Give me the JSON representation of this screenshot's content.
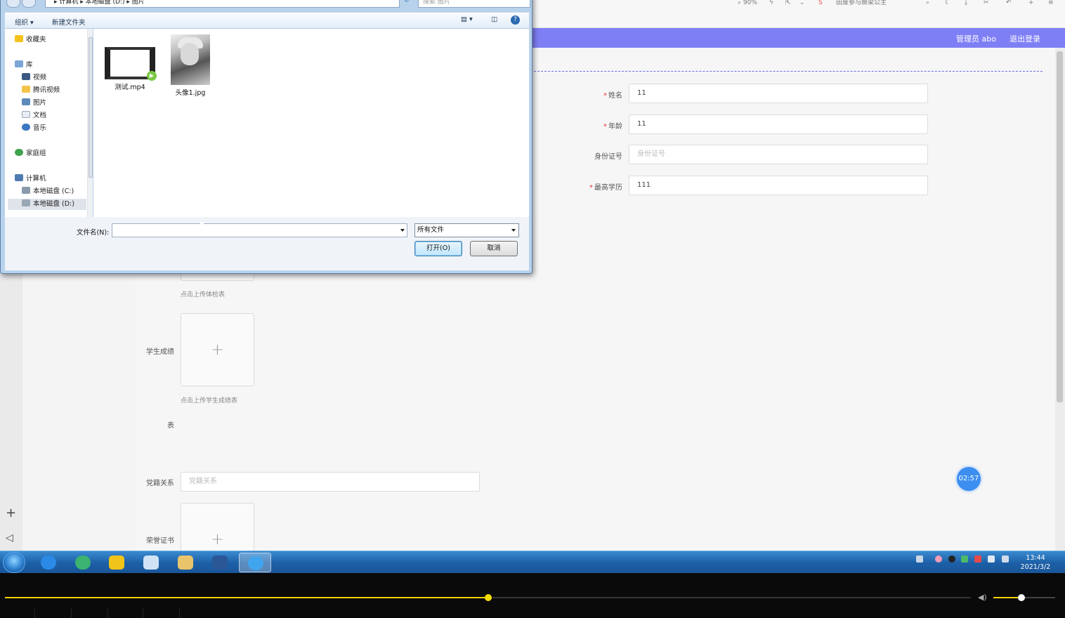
{
  "browser": {
    "zoom": "90%",
    "hot_search": "田度参与撕梁公主"
  },
  "app_header": {
    "admin_label": "管理员 abo",
    "logout_label": "退出登录"
  },
  "form": {
    "name": {
      "label": "姓名",
      "value": "11"
    },
    "age": {
      "label": "年龄",
      "value": "11"
    },
    "id_card": {
      "label": "身份证号",
      "placeholder": "身份证号"
    },
    "education": {
      "label": "最高学历",
      "value": "111"
    },
    "medical_hint": "点击上传体检表",
    "grades_label": "学生成绩",
    "grades_hint": "点击上传学生成绩表",
    "stray_text": "表",
    "party": {
      "label": "党籍关系",
      "placeholder": "党籍关系"
    },
    "honor_label": "荣誉证书"
  },
  "timer_bubble": "02:57",
  "dialog": {
    "address": "▸ 计算机 ▸ 本地磁盘 (D:) ▸ 图片",
    "search_placeholder": "搜索 图片",
    "organize_label": "组织 ▾",
    "new_folder_label": "新建文件夹",
    "nav": {
      "favorites": "收藏夹",
      "libraries": "库",
      "videos": "视频",
      "tencent_video": "腾讯视频",
      "pictures": "图片",
      "documents": "文档",
      "music": "音乐",
      "homegroup": "家庭组",
      "computer": "计算机",
      "drive_c": "本地磁盘 (C:)",
      "drive_d": "本地磁盘 (D:)"
    },
    "files": [
      {
        "name": "测试.mp4",
        "icon": "video-file-icon"
      },
      {
        "name": "头像1.jpg",
        "icon": "photo-file-icon"
      }
    ],
    "filename_label": "文件名(N):",
    "filename_value": "",
    "filter_value": "所有文件",
    "open_label": "打开(O)",
    "cancel_label": "取消"
  },
  "taskbar": {
    "time": "13:44",
    "date": "2021/3/2"
  },
  "player": {
    "progress": 0.5,
    "volume": 0.45
  },
  "colors": {
    "header": "#7f7ff5",
    "accent": "#3c8ef0",
    "progress": "#f0d000"
  }
}
